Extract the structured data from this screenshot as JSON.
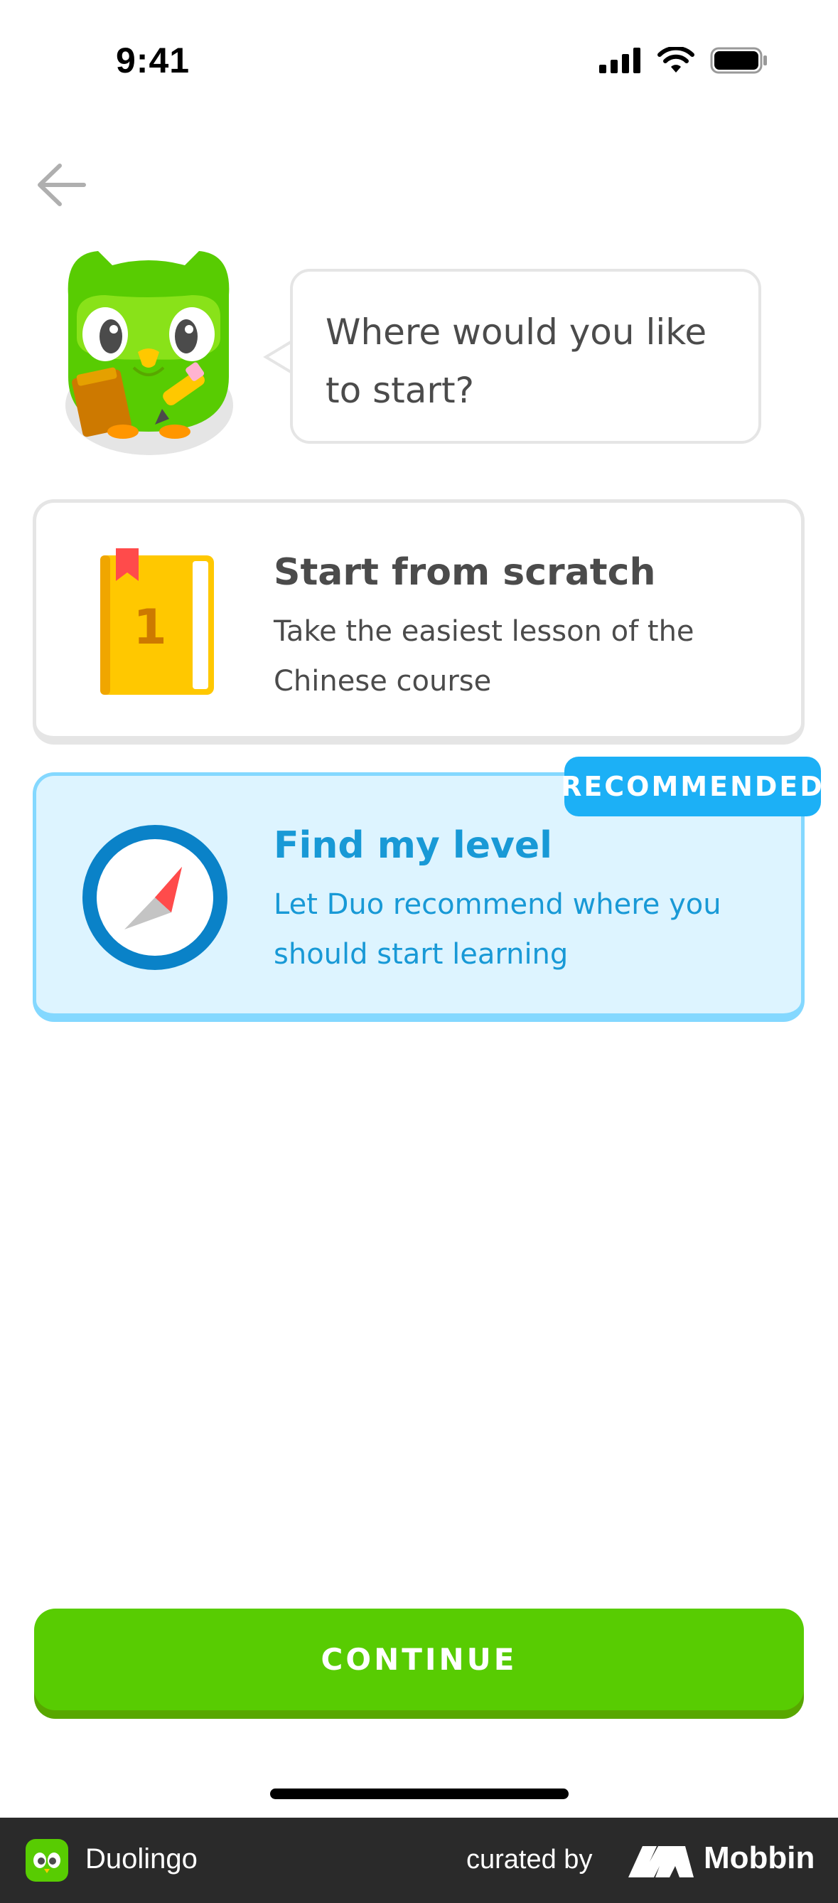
{
  "status_bar": {
    "time": "9:41",
    "icons": [
      "cellular-signal-icon",
      "wifi-icon",
      "battery-icon"
    ]
  },
  "nav": {
    "back_icon": "back-arrow-icon"
  },
  "mascot": {
    "speech": "Where would you like to start?"
  },
  "options": [
    {
      "icon": "book-icon",
      "book_number": "1",
      "title": "Start from scratch",
      "description": "Take the easiest lesson of the Chinese course",
      "selected": false
    },
    {
      "icon": "compass-icon",
      "title": "Find my level",
      "description": "Let Duo recommend where you should start learning",
      "badge": "RECOMMENDED",
      "selected": true
    }
  ],
  "continue_label": "CONTINUE",
  "footer": {
    "app_name": "Duolingo",
    "curated_by": "curated by",
    "brand": "Mobbin"
  },
  "colors": {
    "brand_green": "#58cc02",
    "selected_blue": "#1cb0f6",
    "selected_bg": "#ddf4ff",
    "text_gray": "#4b4b4b"
  }
}
